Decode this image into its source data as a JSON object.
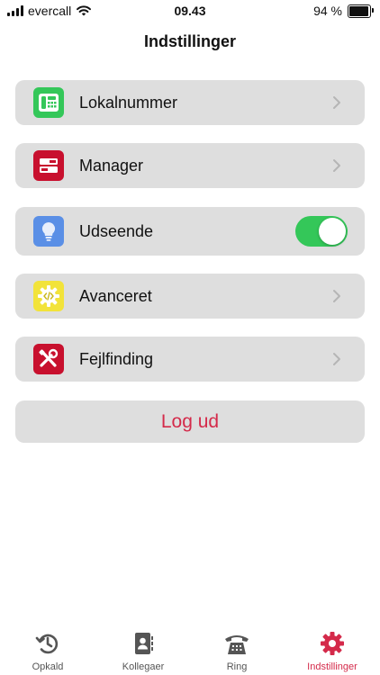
{
  "status_bar": {
    "carrier": "evercall",
    "time": "09.43",
    "battery": "94 %",
    "battery_level": 0.94
  },
  "header": {
    "title": "Indstillinger"
  },
  "settings": {
    "items": [
      {
        "label": "Lokalnummer",
        "icon": "desk-phone-icon",
        "color": "#34c759",
        "type": "link"
      },
      {
        "label": "Manager",
        "icon": "manager-icon",
        "color": "#c8102e",
        "type": "link"
      },
      {
        "label": "Udseende",
        "icon": "lightbulb-icon",
        "color": "#5a8fe6",
        "type": "toggle",
        "toggle_on": true
      },
      {
        "label": "Avanceret",
        "icon": "code-gear-icon",
        "color": "#f2e33a",
        "type": "link"
      },
      {
        "label": "Fejlfinding",
        "icon": "tools-icon",
        "color": "#c8102e",
        "type": "link"
      }
    ],
    "logout_label": "Log ud"
  },
  "tabbar": {
    "tabs": [
      {
        "label": "Opkald",
        "icon": "history-icon",
        "active": false
      },
      {
        "label": "Kollegaer",
        "icon": "contacts-icon",
        "active": false
      },
      {
        "label": "Ring",
        "icon": "phone-keypad-icon",
        "active": false
      },
      {
        "label": "Indstillinger",
        "icon": "gear-icon",
        "active": true
      }
    ],
    "active_color": "#d42a4a"
  }
}
